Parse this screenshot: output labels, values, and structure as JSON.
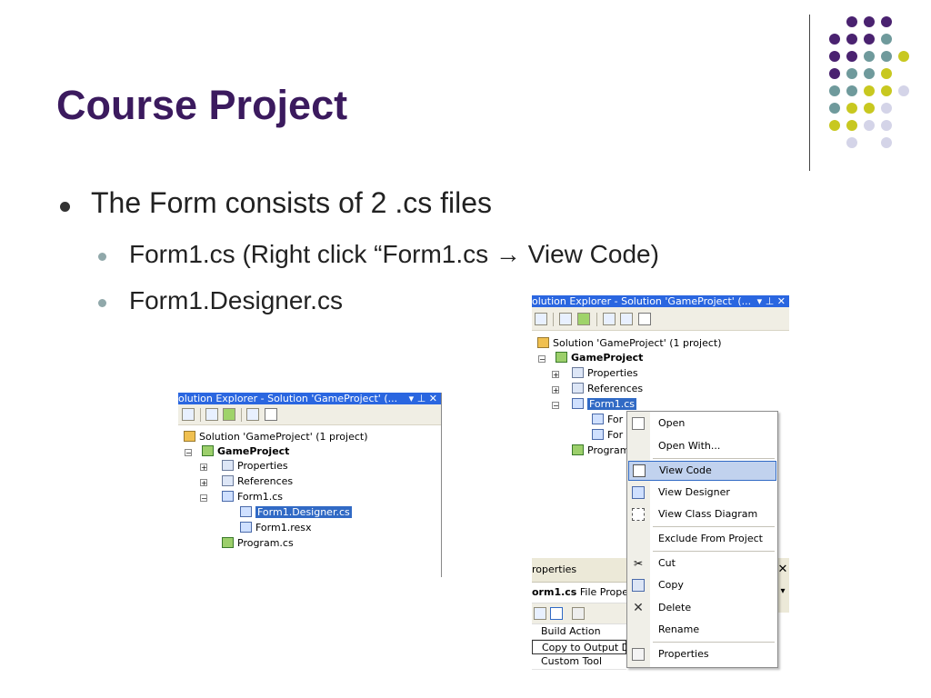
{
  "slide": {
    "title": "Course Project",
    "bullets": [
      "The Form consists of 2 .cs files",
      "Form1.cs (Right click “Form1.cs → View Code)",
      "Form1.Designer.cs"
    ]
  },
  "colors": {
    "title": "#3b1a5e",
    "accent_purple": "#4a2270",
    "accent_teal": "#6f9a9c",
    "accent_lime": "#c8c820",
    "accent_lavender": "#d4d4e8",
    "selection": "#316ac5"
  },
  "left_explorer": {
    "title": "olution Explorer - Solution 'GameProject' (...",
    "title_controls": "▾ ⊥ ✕",
    "tree": [
      "Solution 'GameProject' (1 project)",
      "GameProject",
      "Properties",
      "References",
      "Form1.cs",
      "Form1.Designer.cs",
      "Form1.resx",
      "Program.cs"
    ]
  },
  "right_explorer": {
    "title": "olution Explorer - Solution 'GameProject' (...",
    "title_controls": "▾ ⊥ ✕",
    "tree": [
      "Solution 'GameProject' (1 project)",
      "GameProject",
      "Properties",
      "References",
      "Form1.cs",
      "For",
      "For",
      "Program"
    ]
  },
  "context_menu": {
    "items": [
      "Open",
      "Open With...",
      "View Code",
      "View Designer",
      "View Class Diagram",
      "Exclude From Project",
      "Cut",
      "Copy",
      "Delete",
      "Rename",
      "Properties"
    ],
    "highlighted": "View Code"
  },
  "properties_panel": {
    "header": "roperties",
    "subject": "orm1.cs",
    "subject_rest": "File Prope",
    "rows": [
      "Build Action",
      "Copy to Output Di",
      "Custom Tool"
    ],
    "close": "✕",
    "dropdown": "▾"
  }
}
